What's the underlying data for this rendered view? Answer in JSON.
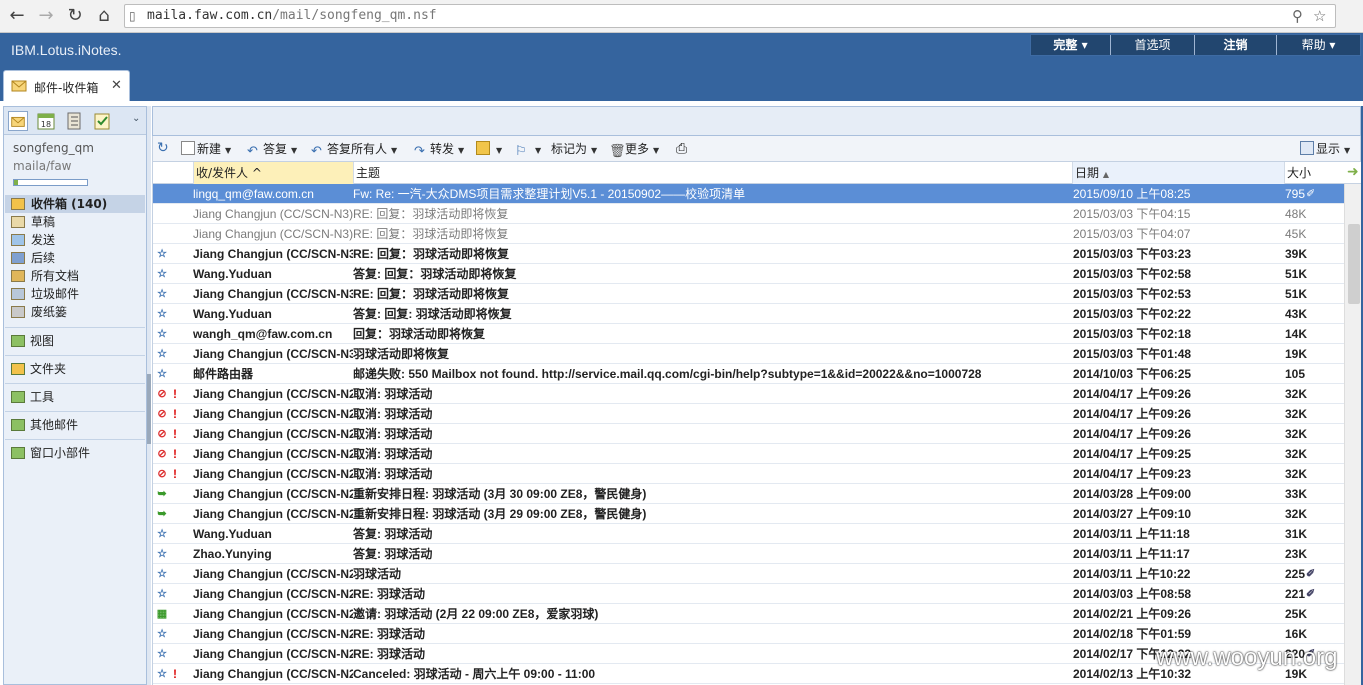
{
  "browser": {
    "url_host": "maila.faw.com.cn",
    "url_path": "/mail/songfeng_qm.nsf"
  },
  "header": {
    "brand": "IBM.Lotus.iNotes.",
    "menu": [
      "完整",
      "首选项",
      "注销",
      "帮助"
    ]
  },
  "tab": {
    "label": "邮件-收件箱"
  },
  "user": {
    "name": "songfeng_qm",
    "db": "maila/faw",
    "quota_fraction": 0.05
  },
  "folders": [
    {
      "label": "收件箱 (140)",
      "icon": "inbox-icon",
      "selected": true
    },
    {
      "label": "草稿",
      "icon": "drafts-icon"
    },
    {
      "label": "发送",
      "icon": "sent-icon"
    },
    {
      "label": "后续",
      "icon": "follow-up-icon"
    },
    {
      "label": "所有文档",
      "icon": "all-documents-icon"
    },
    {
      "label": "垃圾邮件",
      "icon": "junk-icon"
    },
    {
      "label": "废纸篓",
      "icon": "trash-icon"
    }
  ],
  "sections": [
    "视图",
    "文件夹",
    "工具",
    "其他邮件",
    "窗口小部件"
  ],
  "toolbar": {
    "new": "新建",
    "reply": "答复",
    "reply_all": "答复所有人",
    "forward": "转发",
    "mark_as": "标记为",
    "more": "更多",
    "display": "显示"
  },
  "columns": {
    "from": "收/发件人 ^",
    "subject": "主题",
    "date": "日期",
    "size": "大小"
  },
  "messages": [
    {
      "icon": "",
      "pri": "",
      "from": "lingq_qm@faw.com.cn",
      "subject": "Fw: Re: 一汽-大众DMS项目需求整理计划V5.1 - 20150902——校验项清单",
      "date": "2015/09/10 上午08:25",
      "size": "795",
      "attach": "✐",
      "state": "sel"
    },
    {
      "icon": "",
      "pri": "",
      "from": "Jiang Changjun (CC/SCN-N3)",
      "subject": "RE: 回复：羽球活动即将恢复",
      "date": "2015/03/03 下午04:15",
      "size": "48K",
      "attach": "",
      "state": "read"
    },
    {
      "icon": "",
      "pri": "",
      "from": "Jiang Changjun (CC/SCN-N3)",
      "subject": "RE: 回复：羽球活动即将恢复",
      "date": "2015/03/03 下午04:07",
      "size": "45K",
      "attach": "",
      "state": "read"
    },
    {
      "icon": "☆",
      "pri": "",
      "from": "Jiang Changjun (CC/SCN-N3)",
      "subject": "RE: 回复：羽球活动即将恢复",
      "date": "2015/03/03 下午03:23",
      "size": "39K",
      "attach": "",
      "state": "unread"
    },
    {
      "icon": "☆",
      "pri": "",
      "from": "Wang.Yuduan",
      "subject": "答复: 回复：羽球活动即将恢复",
      "date": "2015/03/03 下午02:58",
      "size": "51K",
      "attach": "",
      "state": "unread"
    },
    {
      "icon": "☆",
      "pri": "",
      "from": "Jiang Changjun (CC/SCN-N3)",
      "subject": "RE: 回复：羽球活动即将恢复",
      "date": "2015/03/03 下午02:53",
      "size": "51K",
      "attach": "",
      "state": "unread"
    },
    {
      "icon": "☆",
      "pri": "",
      "from": "Wang.Yuduan",
      "subject": "答复: 回复: 羽球活动即将恢复",
      "date": "2015/03/03 下午02:22",
      "size": "43K",
      "attach": "",
      "state": "unread"
    },
    {
      "icon": "☆",
      "pri": "",
      "from": "wangh_qm@faw.com.cn",
      "subject": "回复：羽球活动即将恢复",
      "date": "2015/03/03 下午02:18",
      "size": "14K",
      "attach": "",
      "state": "unread"
    },
    {
      "icon": "☆",
      "pri": "",
      "from": "Jiang Changjun (CC/SCN-N3)",
      "subject": "羽球活动即将恢复",
      "date": "2015/03/03 下午01:48",
      "size": "19K",
      "attach": "",
      "state": "unread"
    },
    {
      "icon": "☆",
      "pri": "",
      "from": "邮件路由器",
      "subject": "邮递失败: 550 Mailbox not found. http://service.mail.qq.com/cgi-bin/help?subtype=1&&id=20022&&no=1000728",
      "date": "2014/10/03 下午06:25",
      "size": "105",
      "attach": "",
      "state": "unread"
    },
    {
      "icon": "⊘",
      "pri": "!",
      "from": "Jiang Changjun (CC/SCN-N2)",
      "subject": "取消: 羽球活动",
      "date": "2014/04/17 上午09:26",
      "size": "32K",
      "attach": "",
      "state": "unread"
    },
    {
      "icon": "⊘",
      "pri": "!",
      "from": "Jiang Changjun (CC/SCN-N2)",
      "subject": "取消: 羽球活动",
      "date": "2014/04/17 上午09:26",
      "size": "32K",
      "attach": "",
      "state": "unread"
    },
    {
      "icon": "⊘",
      "pri": "!",
      "from": "Jiang Changjun (CC/SCN-N2)",
      "subject": "取消: 羽球活动",
      "date": "2014/04/17 上午09:26",
      "size": "32K",
      "attach": "",
      "state": "unread"
    },
    {
      "icon": "⊘",
      "pri": "!",
      "from": "Jiang Changjun (CC/SCN-N2)",
      "subject": "取消: 羽球活动",
      "date": "2014/04/17 上午09:25",
      "size": "32K",
      "attach": "",
      "state": "unread"
    },
    {
      "icon": "⊘",
      "pri": "!",
      "from": "Jiang Changjun (CC/SCN-N2)",
      "subject": "取消: 羽球活动",
      "date": "2014/04/17 上午09:23",
      "size": "32K",
      "attach": "",
      "state": "unread"
    },
    {
      "icon": "➥",
      "pri": "",
      "from": "Jiang Changjun (CC/SCN-N2)",
      "subject": "重新安排日程: 羽球活动 (3月 30 09:00 ZE8，警民健身)",
      "date": "2014/03/28 上午09:00",
      "size": "33K",
      "attach": "",
      "state": "unread"
    },
    {
      "icon": "➥",
      "pri": "",
      "from": "Jiang Changjun (CC/SCN-N2)",
      "subject": "重新安排日程: 羽球活动 (3月 29 09:00 ZE8，警民健身)",
      "date": "2014/03/27 上午09:10",
      "size": "32K",
      "attach": "",
      "state": "unread"
    },
    {
      "icon": "☆",
      "pri": "",
      "from": "Wang.Yuduan",
      "subject": "答复: 羽球活动",
      "date": "2014/03/11 上午11:18",
      "size": "31K",
      "attach": "",
      "state": "unread"
    },
    {
      "icon": "☆",
      "pri": "",
      "from": "Zhao.Yunying",
      "subject": "答复: 羽球活动",
      "date": "2014/03/11 上午11:17",
      "size": "23K",
      "attach": "",
      "state": "unread"
    },
    {
      "icon": "☆",
      "pri": "",
      "from": "Jiang Changjun (CC/SCN-N2)",
      "subject": "羽球活动",
      "date": "2014/03/11 上午10:22",
      "size": "225",
      "attach": "✐",
      "state": "unread"
    },
    {
      "icon": "☆",
      "pri": "",
      "from": "Jiang Changjun (CC/SCN-N2)",
      "subject": "RE: 羽球活动",
      "date": "2014/03/03 上午08:58",
      "size": "221",
      "attach": "✐",
      "state": "unread"
    },
    {
      "icon": "▦",
      "pri": "",
      "from": "Jiang Changjun (CC/SCN-N2)",
      "subject": "邀请: 羽球活动 (2月 22 09:00 ZE8，爱家羽球)",
      "date": "2014/02/21 上午09:26",
      "size": "25K",
      "attach": "",
      "state": "unread"
    },
    {
      "icon": "☆",
      "pri": "",
      "from": "Jiang Changjun (CC/SCN-N2)",
      "subject": "RE: 羽球活动",
      "date": "2014/02/18 下午01:59",
      "size": "16K",
      "attach": "",
      "state": "unread"
    },
    {
      "icon": "☆",
      "pri": "",
      "from": "Jiang Changjun (CC/SCN-N2)",
      "subject": "RE: 羽球活动",
      "date": "2014/02/17 下午12:32",
      "size": "220",
      "attach": "✐",
      "state": "unread"
    },
    {
      "icon": "☆",
      "pri": "!",
      "from": "Jiang Changjun (CC/SCN-N2)",
      "subject": "Canceled: 羽球活动 - 周六上午 09:00 - 11:00",
      "date": "2014/02/13 上午10:32",
      "size": "19K",
      "attach": "",
      "state": "unread"
    }
  ],
  "watermark": "www.wooyun.org",
  "colors": {
    "header": "#35649e",
    "selected_row": "#5b8ed6",
    "priority": "#d11111"
  }
}
